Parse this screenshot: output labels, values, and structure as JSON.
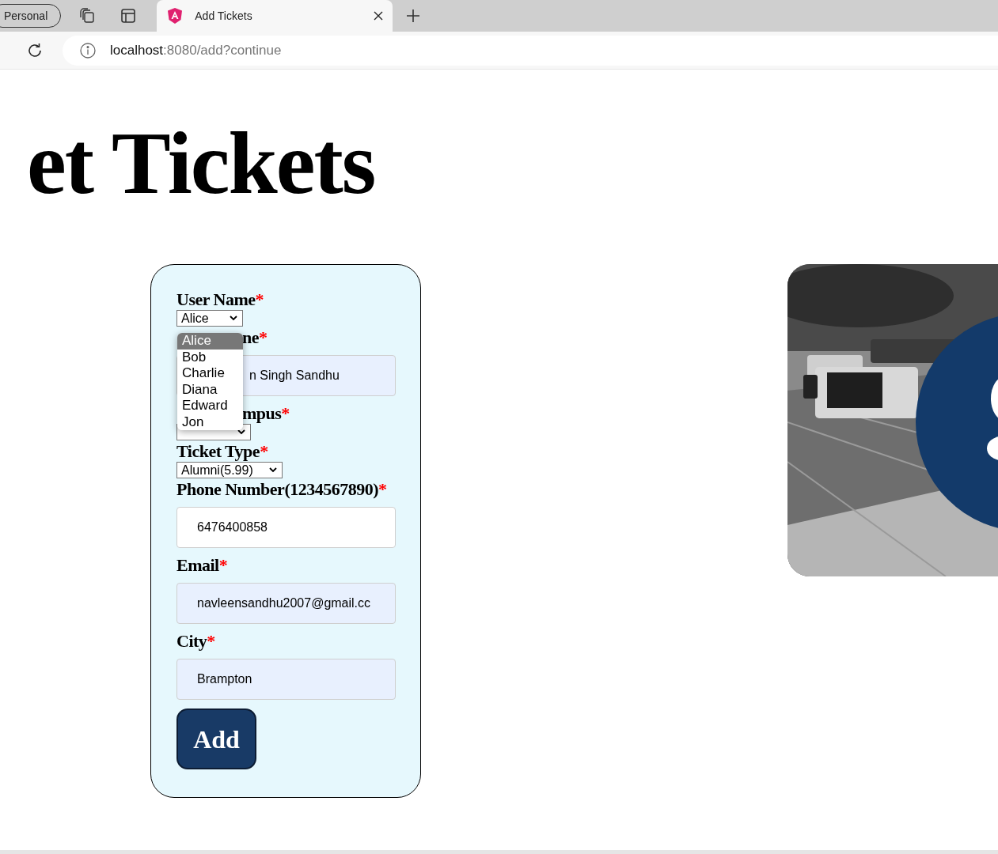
{
  "browser": {
    "profile": "Personal",
    "tabs": [
      {
        "title": "Add Tickets",
        "selected": true
      }
    ],
    "url_host": "localhost",
    "url_rest": ":8080/add?continue"
  },
  "heading": "et Tickets",
  "form": {
    "fields": [
      {
        "kind": "select",
        "label": "User Name",
        "marker": "*",
        "value": "Alice",
        "options": [
          {
            "label": "Alice",
            "selected": true
          },
          {
            "label": "Bob",
            "selected": false
          },
          {
            "label": "Charlie",
            "selected": false
          },
          {
            "label": "Diana",
            "selected": false
          },
          {
            "label": "Edward",
            "selected": false
          },
          {
            "label": "Jon",
            "selected": false
          }
        ]
      },
      {
        "kind": "input",
        "label": "ne",
        "marker": "*",
        "value": "n Singh Sandhu",
        "autofilled": true,
        "partly_hidden": true
      },
      {
        "kind": "select",
        "label": "mpus",
        "marker": "*",
        "partly_hidden": true
      },
      {
        "kind": "select",
        "label": "Ticket Type",
        "marker": "*",
        "value": "Alumni(5.99)"
      },
      {
        "kind": "input",
        "label": "Phone Number(1234567890)",
        "marker": "*",
        "value": "6476400858",
        "autofilled": false
      },
      {
        "kind": "input",
        "label": "Email",
        "marker": "*",
        "value": "navleensandhu2007@gmail.cc",
        "autofilled": true
      },
      {
        "kind": "input",
        "label": "City",
        "marker": "*",
        "value": "Brampton",
        "autofilled": true
      }
    ],
    "button": "Add"
  }
}
